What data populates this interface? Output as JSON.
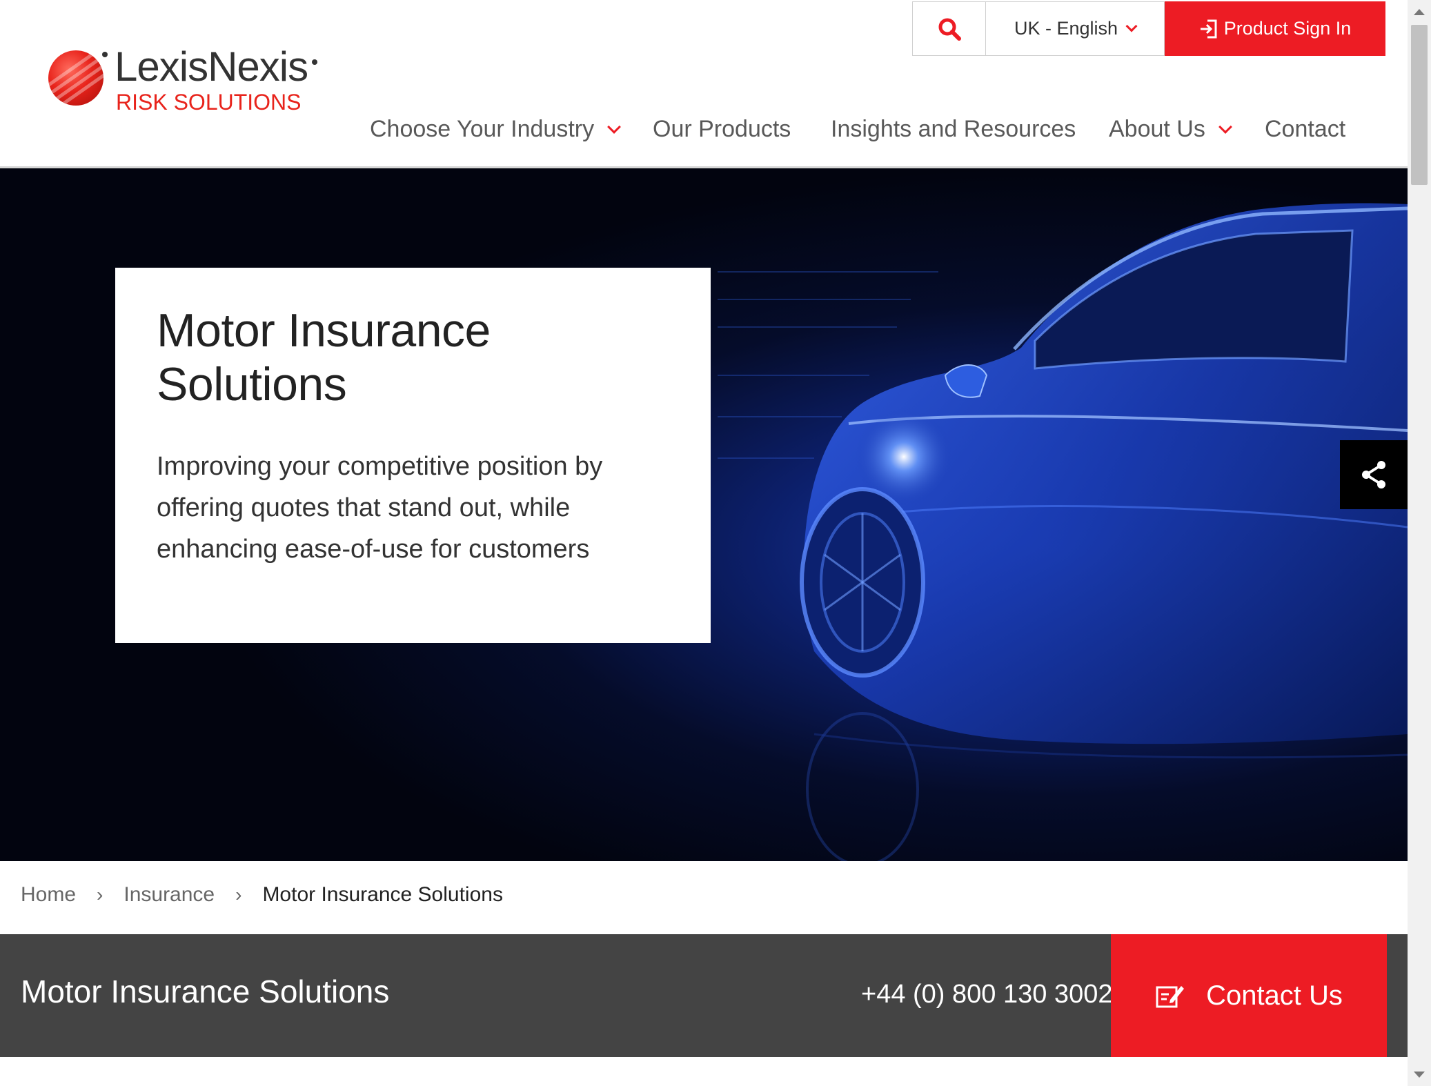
{
  "brand": {
    "name": "LexisNexis",
    "subtitle": "RISK SOLUTIONS",
    "accent_color": "#ed1c24"
  },
  "utility": {
    "search_icon": "search-icon",
    "language": "UK - English",
    "signin_label": "Product Sign In"
  },
  "nav": {
    "items": [
      {
        "label": "Choose Your Industry",
        "has_dropdown": true
      },
      {
        "label": "Our Products",
        "has_dropdown": false
      },
      {
        "label": "Insights and Resources",
        "has_dropdown": false
      },
      {
        "label": "About Us",
        "has_dropdown": true
      },
      {
        "label": "Contact",
        "has_dropdown": false
      }
    ]
  },
  "hero": {
    "title_line1": "Motor Insurance",
    "title_line2": "Solutions",
    "subtitle": "Improving your competitive position by offering quotes that stand out, while enhancing ease-of-use for customers",
    "share_icon": "share-icon"
  },
  "breadcrumb": {
    "home": "Home",
    "insurance": "Insurance",
    "current": "Motor Insurance Solutions",
    "separator": "›"
  },
  "contact_bar": {
    "title": "Motor Insurance Solutions",
    "phone": "+44 (0) 800 130 3002",
    "button_label": "Contact Us",
    "bar_color": "#444444"
  }
}
